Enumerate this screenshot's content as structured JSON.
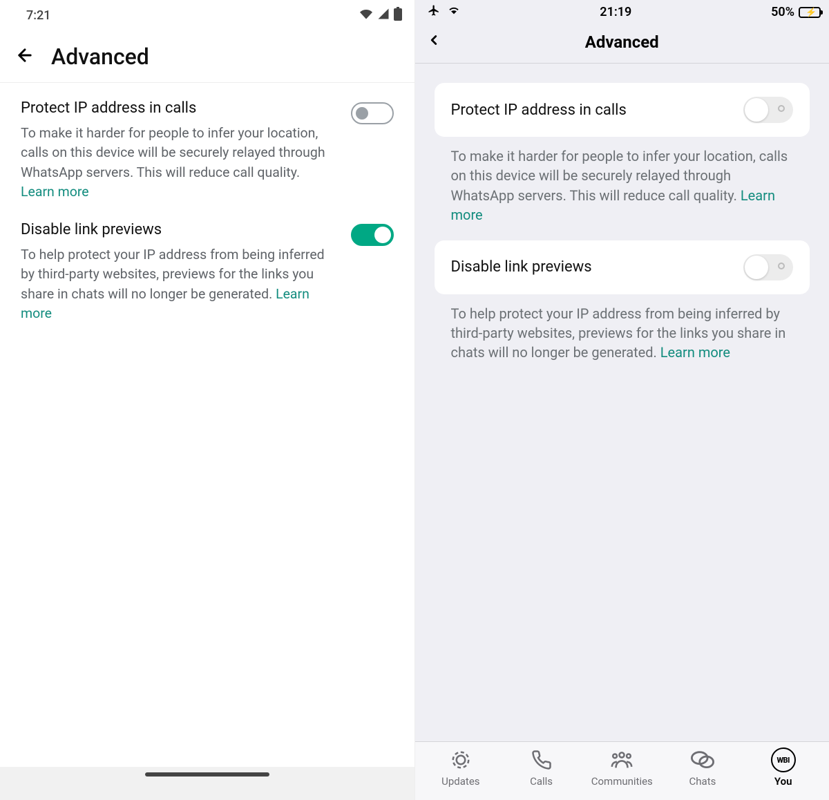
{
  "android": {
    "status_time": "7:21",
    "title": "Advanced",
    "settings": [
      {
        "title": "Protect IP address in calls",
        "desc": "To make it harder for people to infer your location, calls on this device will be securely relayed through WhatsApp servers. This will reduce call quality.",
        "learn": "Learn more",
        "on": false
      },
      {
        "title": "Disable link previews",
        "desc": "To help protect your IP address from being inferred by third-party websites, previews for the links you share in chats will no longer be generated. ",
        "learn": "Learn more",
        "on": true
      }
    ]
  },
  "ios": {
    "status_time": "21:19",
    "battery_pct": "50%",
    "title": "Advanced",
    "settings": [
      {
        "title": "Protect IP address in calls",
        "desc": "To make it harder for people to infer your location, calls on this device will be securely relayed through WhatsApp servers. This will reduce call quality. ",
        "learn": "Learn more",
        "on": false
      },
      {
        "title": "Disable link previews",
        "desc": "To help protect your IP address from being inferred by third-party websites, previews for the links you share in chats will no longer be generated. ",
        "learn": "Learn more",
        "on": false
      }
    ],
    "tabs": [
      {
        "label": "Updates"
      },
      {
        "label": "Calls"
      },
      {
        "label": "Communities"
      },
      {
        "label": "Chats"
      },
      {
        "label": "You"
      }
    ]
  }
}
